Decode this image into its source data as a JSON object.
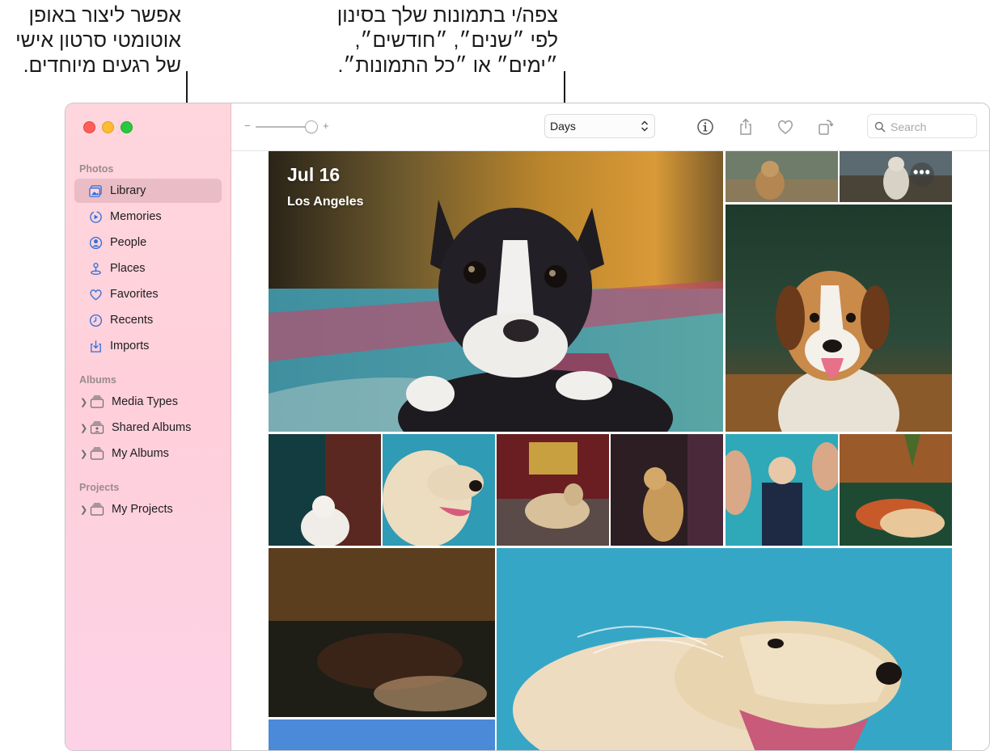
{
  "callouts": {
    "left": [
      "אפשר ליצור באופן",
      "אוטומטי סרטון אישי",
      "של רגעים מיוחדים."
    ],
    "middle": [
      "צפה/י בתמונות שלך בסינון",
      "לפי ״שנים״, ״חודשים״,",
      "״ימים״ או ״כל התמונות״."
    ]
  },
  "sidebar": {
    "sections": {
      "photos": "Photos",
      "albums": "Albums",
      "projects": "Projects"
    },
    "photos_items": [
      {
        "label": "Library",
        "icon": "library-icon",
        "selected": true
      },
      {
        "label": "Memories",
        "icon": "memories-icon"
      },
      {
        "label": "People",
        "icon": "people-icon"
      },
      {
        "label": "Places",
        "icon": "places-icon"
      },
      {
        "label": "Favorites",
        "icon": "heart-icon"
      },
      {
        "label": "Recents",
        "icon": "clock-icon"
      },
      {
        "label": "Imports",
        "icon": "import-icon"
      }
    ],
    "album_items": [
      {
        "label": "Media Types"
      },
      {
        "label": "Shared Albums"
      },
      {
        "label": "My Albums"
      }
    ],
    "project_items": [
      {
        "label": "My Projects"
      }
    ]
  },
  "toolbar": {
    "zoom_minus": "−",
    "zoom_plus": "+",
    "zoom_level": 0.9,
    "view_select": "Days",
    "search_placeholder": "Search"
  },
  "content": {
    "day_title": "Jul 16",
    "day_location": "Los Angeles",
    "more_label": "•••"
  },
  "colors": {
    "sidebar_bg": "#ffd3dd",
    "accent": "#2f6fdb"
  }
}
